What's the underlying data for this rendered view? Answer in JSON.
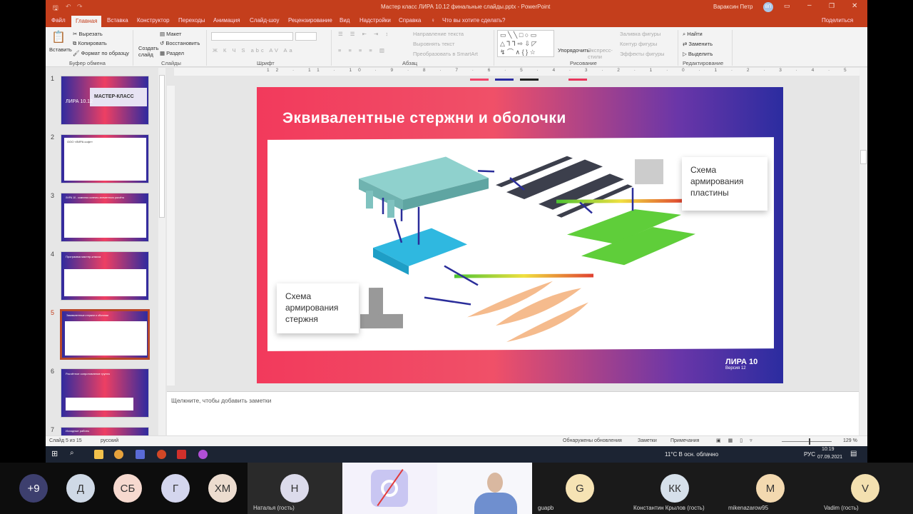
{
  "window": {
    "title": "Мастер класс ЛИРА 10.12 финальные слайды.pptx  -  PowerPoint",
    "user": "Вараксин Петр",
    "user_initials": "ВП",
    "share": "Поделиться",
    "search": "Что вы хотите сделать?"
  },
  "tabs": [
    "Файл",
    "Главная",
    "Вставка",
    "Конструктор",
    "Переходы",
    "Анимация",
    "Слайд-шоу",
    "Рецензирование",
    "Вид",
    "Надстройки",
    "Справка"
  ],
  "ribbon": {
    "clipboard": {
      "paste": "Вставить",
      "cut": "Вырезать",
      "copy": "Копировать",
      "format": "Формат по образцу",
      "group": "Буфер обмена"
    },
    "slides": {
      "new": "Создать слайд",
      "layout": "Макет",
      "reset": "Восстановить",
      "section": "Раздел",
      "group": "Слайды"
    },
    "font": {
      "group": "Шрифт",
      "styles": "Ж К Ч S abc AV Aa"
    },
    "paragraph": {
      "direction": "Направление текста",
      "align": "Выровнять текст",
      "smartart": "Преобразовать в SmartArt",
      "group": "Абзац"
    },
    "drawing": {
      "arrange": "Упорядочить",
      "quick": "Экспресс-стили",
      "fill": "Заливка фигуры",
      "outline": "Контур фигуры",
      "effects": "Эффекты фигуры",
      "group": "Рисование"
    },
    "editing": {
      "find": "Найти",
      "replace": "Заменить",
      "select": "Выделить",
      "group": "Редактирование"
    }
  },
  "ruler": "12 · 11 · 10 · 9 · 8 · 7 · 6 · 5 · 4 · 3 · 2 · 1 · 0 · 1 · 2 · 3 · 4 · 5 · 6 · 7 · 8 · 9 · 10 · 11 · 12",
  "thumbnails": [
    {
      "n": "1",
      "text": "МАСТЕР-КЛАСС",
      "sub": "ЛИРА 10.12"
    },
    {
      "n": "2",
      "text": "ООО «ЛИРА софт»"
    },
    {
      "n": "3",
      "text": "ЛИРА 10 - комплекс конечно-элементного расчёта"
    },
    {
      "n": "4",
      "text": "Программа мастер-класса"
    },
    {
      "n": "5",
      "text": "Эквивалентные стержни и оболочки"
    },
    {
      "n": "6",
      "text": "Расчётное сопротивление грунта"
    },
    {
      "n": "7",
      "text": "Исходные работы"
    }
  ],
  "slide": {
    "title": "Эквивалентные стержни и оболочки",
    "cap_plate": "Схема армирования пластины",
    "cap_bar": "Схема армирования стержня",
    "logo": "ЛИРА 10",
    "version": "Версия 12"
  },
  "notes_placeholder": "Щелкните, чтобы добавить заметки",
  "status": {
    "slide": "Слайд 5 из 15",
    "lang": "русский",
    "updates": "Обнаружены обновления",
    "notes": "Заметки",
    "comments": "Примечания",
    "zoom": "129 %"
  },
  "taskbar": {
    "weather": "11°C  В осн. облачно",
    "lang": "РУС",
    "time": "10:19",
    "date": "07.09.2021"
  },
  "participants": [
    {
      "initials": "+9",
      "color": "#3d3f6e",
      "text": "#fff"
    },
    {
      "initials": "Д",
      "color": "#cfd9e6"
    },
    {
      "initials": "СБ",
      "color": "#f6d9cf"
    },
    {
      "initials": "Г",
      "color": "#d4d6ee"
    },
    {
      "initials": "ХМ",
      "color": "#ecdccf"
    }
  ],
  "tiles": [
    {
      "initials": "Н",
      "name": "Наталья (гость)",
      "color": "#dcdbeb"
    },
    {
      "initials": "G",
      "name": "guapb",
      "color": "#f6e3b4"
    },
    {
      "initials": "КК",
      "name": "Константин Крылов (гость)",
      "color": "#d6e0ea"
    },
    {
      "initials": "M",
      "name": "mikenazarow95",
      "color": "#f3d9b0"
    },
    {
      "initials": "V",
      "name": "Vadim (гость)",
      "color": "#f3e0b0"
    }
  ]
}
